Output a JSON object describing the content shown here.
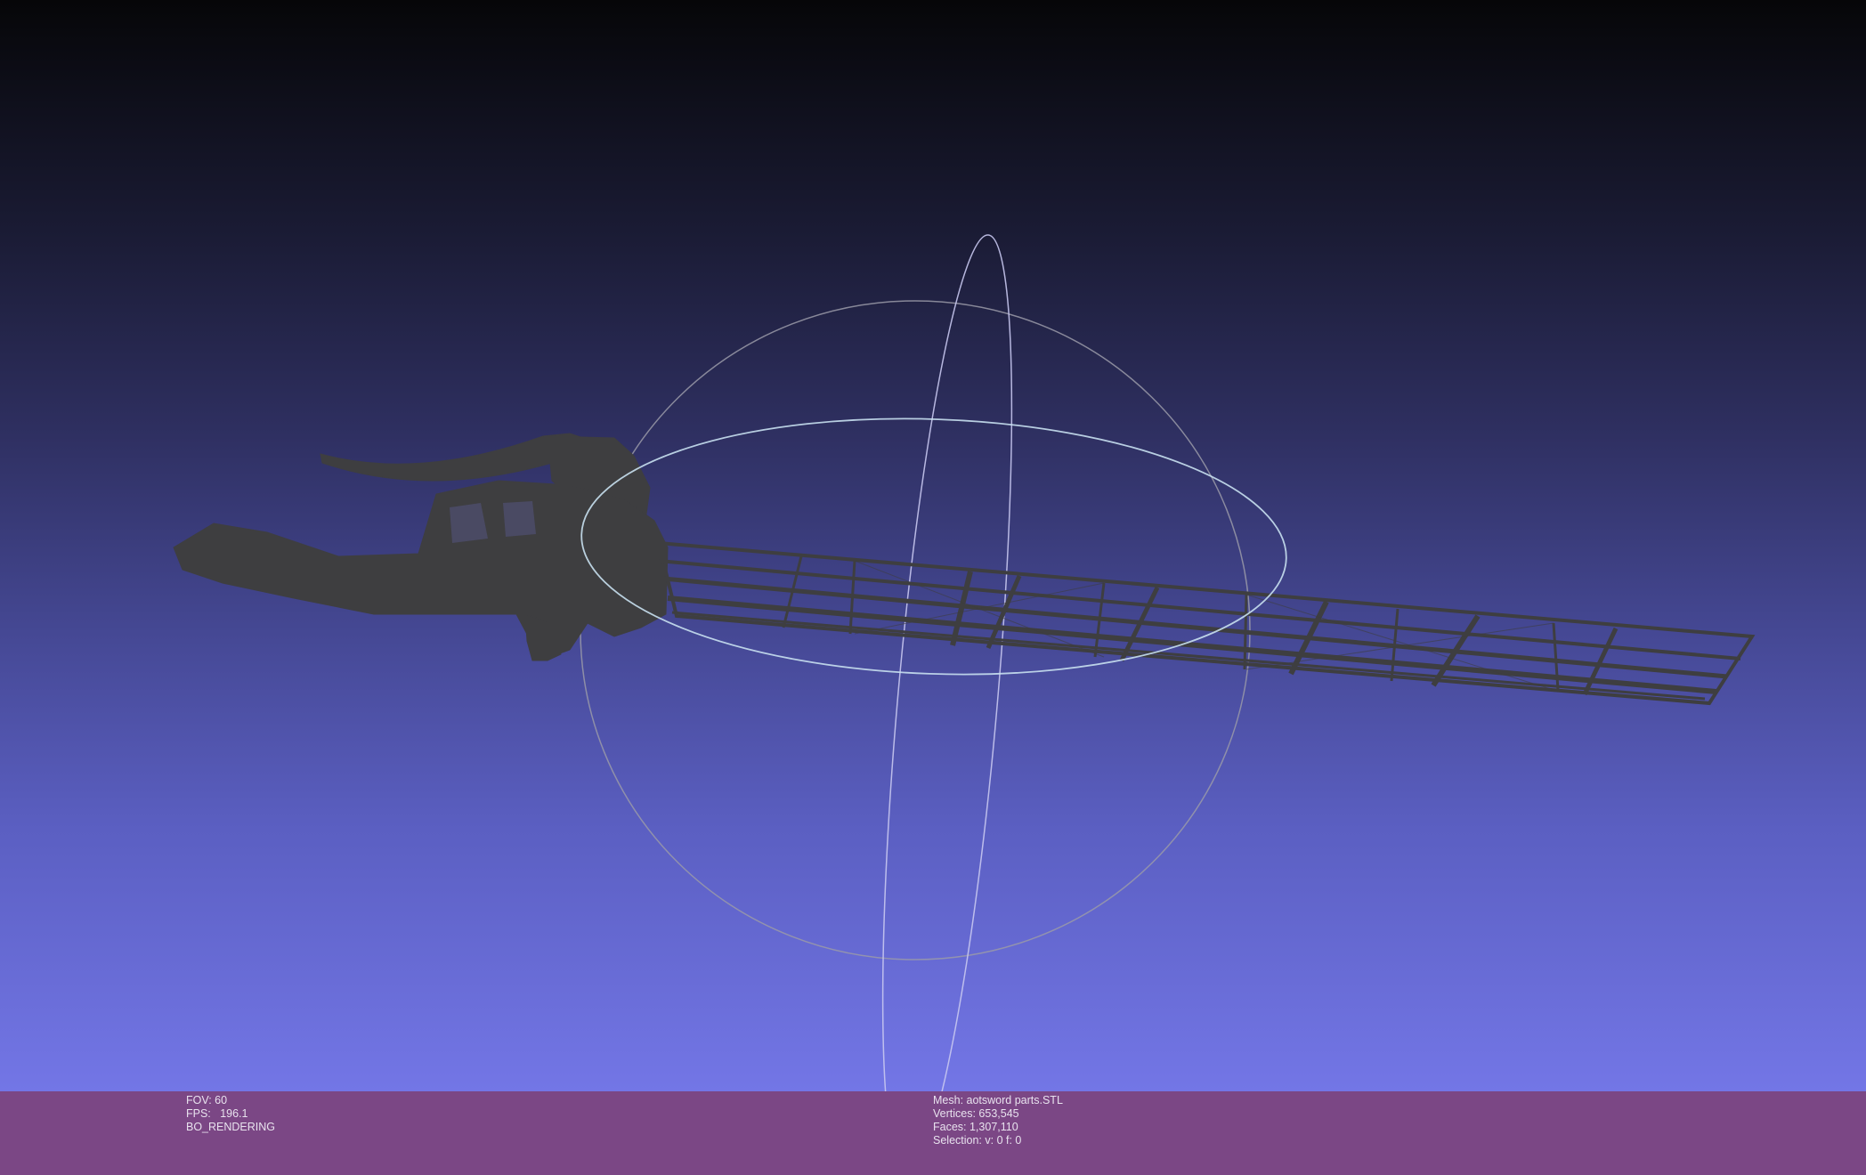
{
  "viewport": {
    "background_top": "#060608",
    "background_bottom": "#7376e6",
    "mesh_color": "#3f3f40",
    "trackball_colors": [
      "#9a9aa8",
      "#c8e0f0",
      "#c8c8f0"
    ]
  },
  "info_left": {
    "fov": "FOV: 60",
    "fps": "FPS:   196.1",
    "mode": "BO_RENDERING"
  },
  "info_right": {
    "mesh": "Mesh: aotsword parts.STL",
    "vertices": "Vertices: 653,545",
    "faces": "Faces: 1,307,110",
    "selection": "Selection: v: 0 f: 0"
  },
  "infobar_color": "#7b4785"
}
